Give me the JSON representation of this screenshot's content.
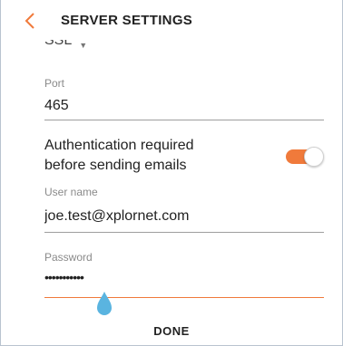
{
  "header": {
    "title": "SERVER SETTINGS",
    "back_icon": "chevron-left-icon"
  },
  "security": {
    "value_peek": "SSL"
  },
  "port": {
    "label": "Port",
    "value": "465"
  },
  "authentication": {
    "label_line1": "Authentication required",
    "label_line2": "before sending emails",
    "enabled": true
  },
  "username": {
    "label": "User name",
    "value": "joe.test@xplornet.com"
  },
  "password": {
    "label": "Password",
    "value": "•••••••••••"
  },
  "footer": {
    "done_label": "DONE"
  },
  "colors": {
    "accent": "#f07a3b",
    "cursor_handle": "#5ab4e0"
  }
}
